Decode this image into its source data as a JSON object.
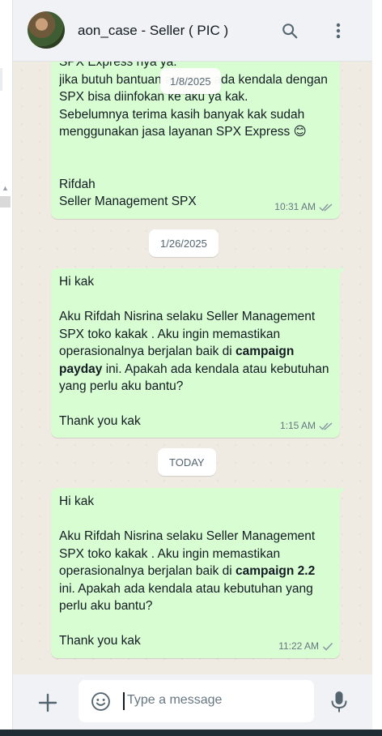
{
  "header": {
    "contact_name": "aon_case - Seller ( PIC )"
  },
  "messages": [
    {
      "lines": [
        "SPX Express nya ya.",
        "jika butuh bantuan ataupun ada kendala dengan",
        "SPX bisa diinfokan ke aku ya kak.",
        "Sebelumnya terima kasih banyak kak sudah",
        "menggunakan jasa layanan SPX Express 😊",
        "",
        "",
        "Rifdah",
        "Seller Management SPX"
      ],
      "time": "10:31 AM",
      "status": "read"
    },
    {
      "line1": "Hi kak",
      "line2": "Aku Rifdah Nisrina selaku Seller Management",
      "line3": "SPX toko kakak . Aku ingin memastikan",
      "line4_pre": "operasionalnya berjalan baik di ",
      "line4_bold": "campaign",
      "line5_bold": "payday",
      "line5_post": " ini. Apakah ada kendala atau kebutuhan",
      "line6": "yang perlu aku bantu?",
      "line7": "Thank you kak",
      "time": "1:15 AM",
      "status": "read"
    },
    {
      "line1": "Hi kak",
      "line2": "Aku Rifdah Nisrina selaku Seller Management",
      "line3": "SPX toko kakak . Aku ingin memastikan",
      "line4_pre": "operasionalnya berjalan baik di ",
      "line4_bold": "campaign 2.2",
      "line5": "ini. Apakah ada kendala atau kebutuhan yang",
      "line6": "perlu aku bantu?",
      "line7": "Thank you kak",
      "time": "11:22 AM",
      "status": "delivered"
    }
  ],
  "date_chips": {
    "floating": "1/8/2025",
    "chip2": "1/26/2025",
    "chip3": "TODAY"
  },
  "composer": {
    "placeholder": "Type a message"
  },
  "icons": {
    "search": "search-icon",
    "menu": "kebab-menu-icon",
    "attach": "plus-icon",
    "emoji": "emoji-icon",
    "mic": "microphone-icon",
    "read": "double-check-icon",
    "delivered": "single-check-icon"
  },
  "colors": {
    "outgoing_bubble": "#d9fdd3",
    "chat_bg": "#efeae2",
    "header_bg": "#f0f2f5",
    "read_tick": "#8696a0"
  }
}
